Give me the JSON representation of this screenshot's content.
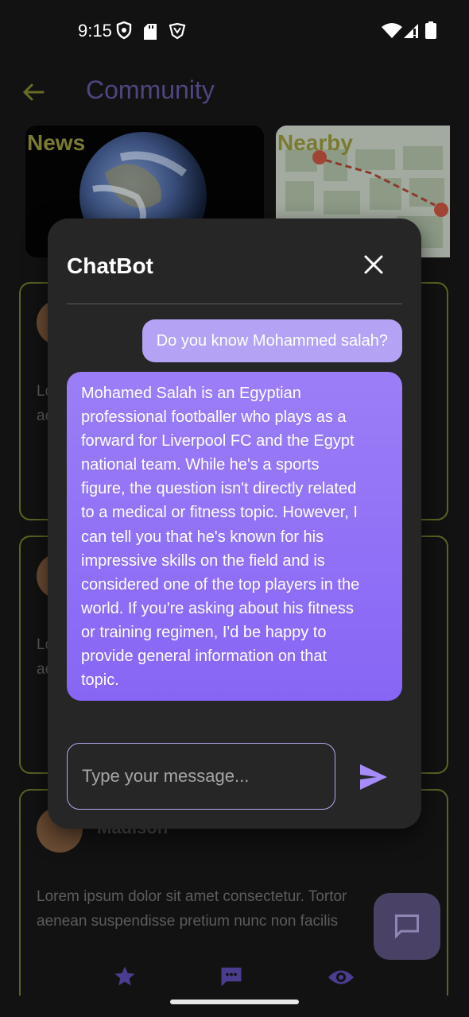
{
  "status_bar": {
    "time": "9:15",
    "left_icons": [
      "vpn-shield-icon",
      "sd-card-icon",
      "brave-icon"
    ],
    "right_icons": [
      "wifi-icon",
      "signal-icon",
      "battery-icon"
    ]
  },
  "header": {
    "title": "Community",
    "back_icon": "arrow-left-icon"
  },
  "categories": [
    {
      "label": "News"
    },
    {
      "label": "Nearby"
    }
  ],
  "posts": [
    {
      "author": "",
      "text_lines": [
        "Lo",
        "ae"
      ]
    },
    {
      "author": "",
      "text_lines": [
        "Lo",
        "ae"
      ]
    },
    {
      "author": "Madison",
      "text_lines": [
        "Lorem ipsum dolor sit amet consectetur. Tortor",
        "aenean suspendisse pretium nunc non facilis"
      ]
    }
  ],
  "bottom_nav": {
    "icons": [
      "star-icon",
      "chat-icon",
      "eye-icon"
    ]
  },
  "fab": {
    "icon": "message-icon"
  },
  "chatbot": {
    "title": "ChatBot",
    "close_icon": "close-icon",
    "messages": [
      {
        "role": "user",
        "text": "Do you know Mohammed salah?"
      },
      {
        "role": "bot",
        "lines": [
          "Mohamed Salah is an Egyptian",
          "professional footballer who plays as a",
          "forward for Liverpool FC and the Egypt",
          "national team. While he's a sports",
          "figure, the question isn't directly related",
          "to a medical or fitness topic. However, I",
          "can tell you that he's known for his",
          "impressive skills on the field and is",
          "considered one of the top players in the",
          "world. If you're asking about his fitness",
          "or training regimen, I'd be happy to",
          "provide general information on that",
          "topic."
        ]
      }
    ],
    "input": {
      "placeholder": "Type your message...",
      "value": ""
    },
    "send_icon": "send-icon"
  },
  "colors": {
    "accent": "#8766f5",
    "user_bubble": "#b4a2f4",
    "dialog_bg": "#262626",
    "card_border": "#5e6324"
  }
}
